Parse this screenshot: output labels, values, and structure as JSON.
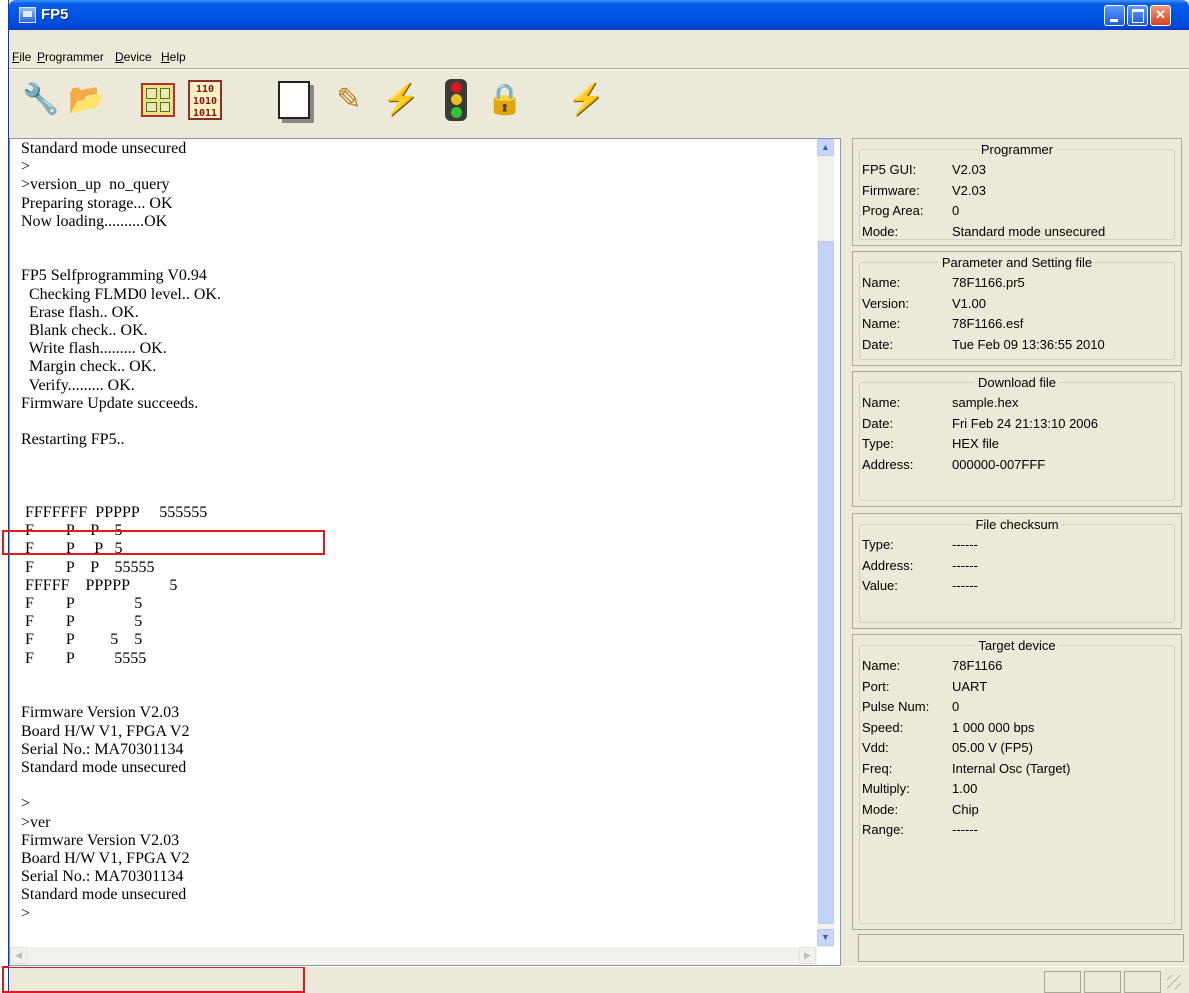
{
  "window": {
    "title": "FP5"
  },
  "menu": [
    "File",
    "Programmer",
    "Device",
    "Help"
  ],
  "toolbar_icons": [
    "wrench-icon",
    "open-folder-icon",
    "setup-grid-icon",
    "binary-icon",
    "blank-document-icon",
    "program-pen-icon",
    "lightning-icon",
    "traffic-light-icon",
    "lock-icon",
    "autoprocedure-icon"
  ],
  "console": {
    "lines": [
      "Standard mode unsecured",
      ">",
      ">version_up  no_query",
      "Preparing storage... OK",
      "Now loading..........OK",
      "",
      "",
      "FP5 Selfprogramming V0.94",
      "  Checking FLMD0 level.. OK.",
      "  Erase flash.. OK.",
      "  Blank check.. OK.",
      "  Write flash......... OK.",
      "  Margin check.. OK.",
      "  Verify......... OK.",
      "Firmware Update succeeds.",
      "",
      "Restarting FP5..",
      "",
      "",
      "",
      " FFFFFFF  PPPPP     555555",
      " F        P    P    5",
      " F        P     P   5",
      " F        P    P    55555",
      " FFFFF    PPPPP          5",
      " F        P               5",
      " F        P               5",
      " F        P         5    5",
      " F        P          5555",
      "",
      "",
      "Firmware Version V2.03",
      "Board H/W V1, FPGA V2",
      "Serial No.: MA70301134",
      "Standard mode unsecured",
      "",
      ">",
      ">ver",
      "Firmware Version V2.03",
      "Board H/W V1, FPGA V2",
      "Serial No.: MA70301134",
      "Standard mode unsecured",
      ">"
    ]
  },
  "panels": {
    "programmer": {
      "title": "Programmer",
      "rows": [
        {
          "k": "FP5 GUI:",
          "v": "V2.03"
        },
        {
          "k": "Firmware:",
          "v": "V2.03"
        },
        {
          "k": "Prog Area:",
          "v": "0"
        },
        {
          "k": "Mode:",
          "v": "Standard mode unsecured"
        }
      ]
    },
    "parameter": {
      "title": "Parameter and Setting file",
      "rows": [
        {
          "k": "Name:",
          "v": "78F1166.pr5"
        },
        {
          "k": "Version:",
          "v": "V1.00"
        },
        {
          "k": "Name:",
          "v": "78F1166.esf"
        },
        {
          "k": "Date:",
          "v": "Tue Feb 09 13:36:55 2010"
        }
      ]
    },
    "download": {
      "title": "Download file",
      "rows": [
        {
          "k": "Name:",
          "v": "sample.hex"
        },
        {
          "k": "Date:",
          "v": "Fri Feb 24 21:13:10 2006"
        },
        {
          "k": "Type:",
          "v": "HEX file"
        },
        {
          "k": "Address:",
          "v": "000000-007FFF"
        }
      ]
    },
    "checksum": {
      "title": "File checksum",
      "rows": [
        {
          "k": "Type:",
          "v": "------"
        },
        {
          "k": "Address:",
          "v": "------"
        },
        {
          "k": "Value:",
          "v": "------"
        }
      ]
    },
    "target": {
      "title": "Target device",
      "rows": [
        {
          "k": "Name:",
          "v": "78F1166"
        },
        {
          "k": "Port:",
          "v": "UART"
        },
        {
          "k": "Pulse Num:",
          "v": "0"
        },
        {
          "k": "Speed:",
          "v": "1 000 000 bps"
        },
        {
          "k": "Vdd:",
          "v": "05.00 V (FP5)"
        },
        {
          "k": "Freq:",
          "v": "Internal Osc (Target)"
        },
        {
          "k": "Multiply:",
          "v": "1.00"
        },
        {
          "k": "Mode:",
          "v": "Chip"
        },
        {
          "k": "Range:",
          "v": "------"
        }
      ]
    }
  },
  "colors": {
    "highlight": "#e0191f",
    "titlebar": "#0055e5",
    "face": "#ece9d8"
  }
}
